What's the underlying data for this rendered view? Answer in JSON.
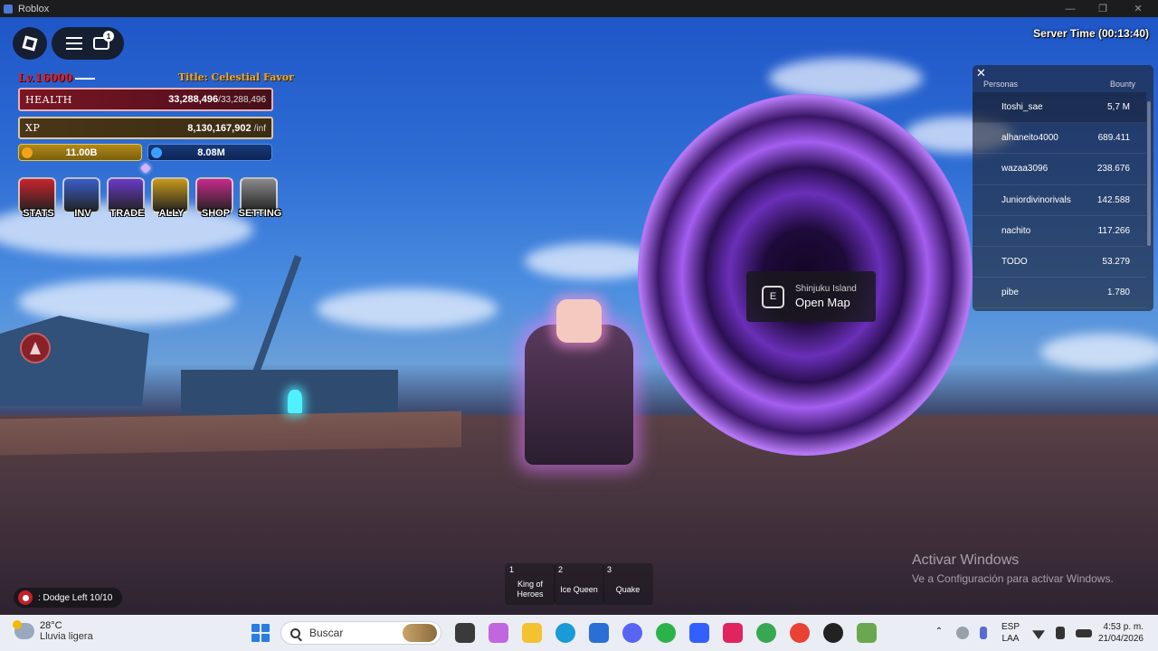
{
  "window": {
    "title": "Roblox"
  },
  "chat": {
    "badge": "1"
  },
  "server_time": "Server Time (00:13:40)",
  "player": {
    "level": "Lv.16000",
    "title": "Title: Celestial Favor",
    "health_label": "HEALTH",
    "health_current": "33,288,496",
    "health_max": "/33,288,496",
    "xp_label": "XP",
    "xp_current": "8,130,167,902",
    "xp_max": "/inf",
    "gold": "11.00B",
    "gems": "8.08M"
  },
  "menu_buttons": [
    {
      "label": "STATS",
      "color": "#c8242c"
    },
    {
      "label": "INV",
      "color": "#3a5ec8"
    },
    {
      "label": "TRADE",
      "color": "#6a3ac8"
    },
    {
      "label": "ALLY",
      "color": "#c89a1a"
    },
    {
      "label": "SHOP",
      "color": "#c82a8a"
    },
    {
      "label": "SETTING",
      "color": "#8a8a8a"
    }
  ],
  "prompt": {
    "key": "E",
    "location": "Shinjuku Island",
    "action": "Open Map"
  },
  "leaderboard": {
    "col_name": "Personas",
    "col_value": "Bounty",
    "rows": [
      {
        "name": "Itoshi_sae",
        "value": "5,7 M"
      },
      {
        "name": "alhaneito4000",
        "value": "689.411"
      },
      {
        "name": "wazaa3096",
        "value": "238.676"
      },
      {
        "name": "Juniordivinorivals",
        "value": "142.588"
      },
      {
        "name": "nachito",
        "value": "117.266"
      },
      {
        "name": "TODO",
        "value": "53.279"
      },
      {
        "name": "pibe",
        "value": "1.780"
      }
    ]
  },
  "hotbar": [
    {
      "slot": "1",
      "name_line1": "King of",
      "name_line2": "Heroes"
    },
    {
      "slot": "2",
      "name_line1": "Ice Queen",
      "name_line2": ""
    },
    {
      "slot": "3",
      "name_line1": "Quake",
      "name_line2": ""
    }
  ],
  "dodge": ": Dodge Left 10/10",
  "activation": {
    "title": "Activar Windows",
    "subtitle": "Ve a Configuración para activar Windows."
  },
  "taskbar": {
    "temperature": "28°C",
    "weather": "Lluvia ligera",
    "search_placeholder": "Buscar",
    "language_line1": "ESP",
    "language_line2": "LAA",
    "time": "4:53 p. m.",
    "date": "21/04/2026",
    "apps": [
      {
        "name": "task-view-icon",
        "color": "#3a3a3a"
      },
      {
        "name": "copilot-icon",
        "color": "#c266e0"
      },
      {
        "name": "file-explorer-icon",
        "color": "#f2c230"
      },
      {
        "name": "edge-icon",
        "color": "#1a9ad6"
      },
      {
        "name": "store-icon",
        "color": "#2a6fd6"
      },
      {
        "name": "discord-icon",
        "color": "#5865f2"
      },
      {
        "name": "chrome-icon",
        "color": "#2bb34a"
      },
      {
        "name": "roblox-icon",
        "color": "#335fff"
      },
      {
        "name": "tiktok-icon",
        "color": "#e0245e"
      },
      {
        "name": "chrome-profile-icon",
        "color": "#36a852"
      },
      {
        "name": "chrome-alt-icon",
        "color": "#e94235"
      },
      {
        "name": "obs-icon",
        "color": "#222222"
      },
      {
        "name": "minecraft-icon",
        "color": "#6aa84f"
      }
    ]
  }
}
